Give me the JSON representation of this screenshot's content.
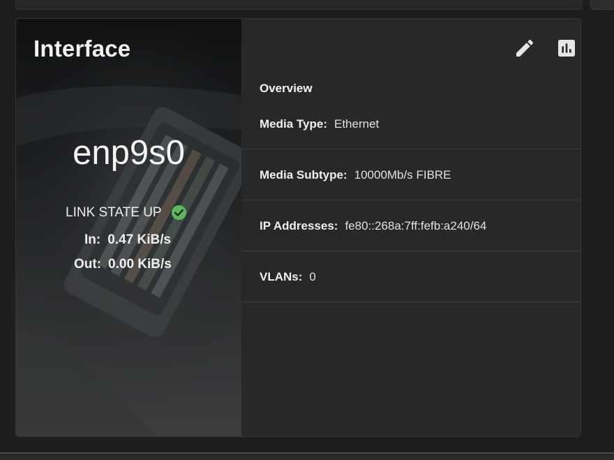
{
  "card": {
    "title": "Interface",
    "interface_name": "enp9s0",
    "link_state": "LINK STATE UP",
    "traffic": {
      "in_label": "In:",
      "in_value": "0.47 KiB/s",
      "out_label": "Out:",
      "out_value": "0.00 KiB/s"
    }
  },
  "toolbar": {
    "edit_icon": "pencil-icon",
    "reports_icon": "bar-chart-icon"
  },
  "overview": {
    "title": "Overview",
    "rows": [
      {
        "label": "Media Type:",
        "value": "Ethernet"
      },
      {
        "label": "Media Subtype:",
        "value": "10000Mb/s FIBRE"
      },
      {
        "label": "IP Addresses:",
        "value": "fe80::268a:7ff:fefb:a240/64"
      },
      {
        "label": "VLANs:",
        "value": "0"
      }
    ]
  },
  "colors": {
    "status_ok": "#5cb85c",
    "card_bg": "#282828",
    "text": "#f0f0f0"
  }
}
